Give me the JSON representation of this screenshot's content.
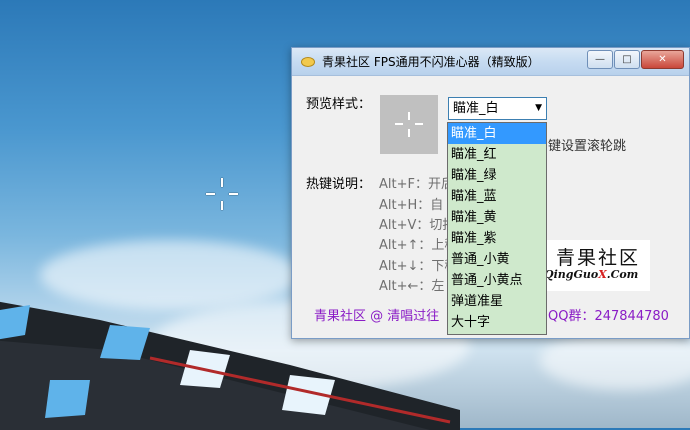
{
  "window": {
    "title": "青果社区 FPS通用不闪准心器（精致版）",
    "minimize_label": "—",
    "maximize_label": "□",
    "close_label": "✕"
  },
  "preview": {
    "label": "预览样式："
  },
  "style_select": {
    "selected": "瞄准_白",
    "options": [
      "瞄准_白",
      "瞄准_红",
      "瞄准_绿",
      "瞄准_蓝",
      "瞄准_黄",
      "瞄准_紫",
      "普通_小黄",
      "普通_小黄点",
      "弹道准星",
      "大十字"
    ]
  },
  "hint_tail": "键设置滚轮跳",
  "hotkeys": {
    "label": "热键说明：",
    "lines": [
      "Alt+F：开后",
      "Alt+H：自",
      "Alt+V：切拍",
      "Alt+↑：上移",
      "Alt+↓：下移",
      "Alt+←：左"
    ]
  },
  "logo": {
    "cn": "青果社区",
    "url_prefix": "QingGuo",
    "url_x": "X",
    "url_suffix": ".Com"
  },
  "footer": {
    "left": "青果社区 @ 清唱过往",
    "right": "QQ群：247844780"
  },
  "colors": {
    "footer_text": "#8a1cc6",
    "dropdown_bg": "#cfe9cc",
    "selection": "#3399ff"
  }
}
